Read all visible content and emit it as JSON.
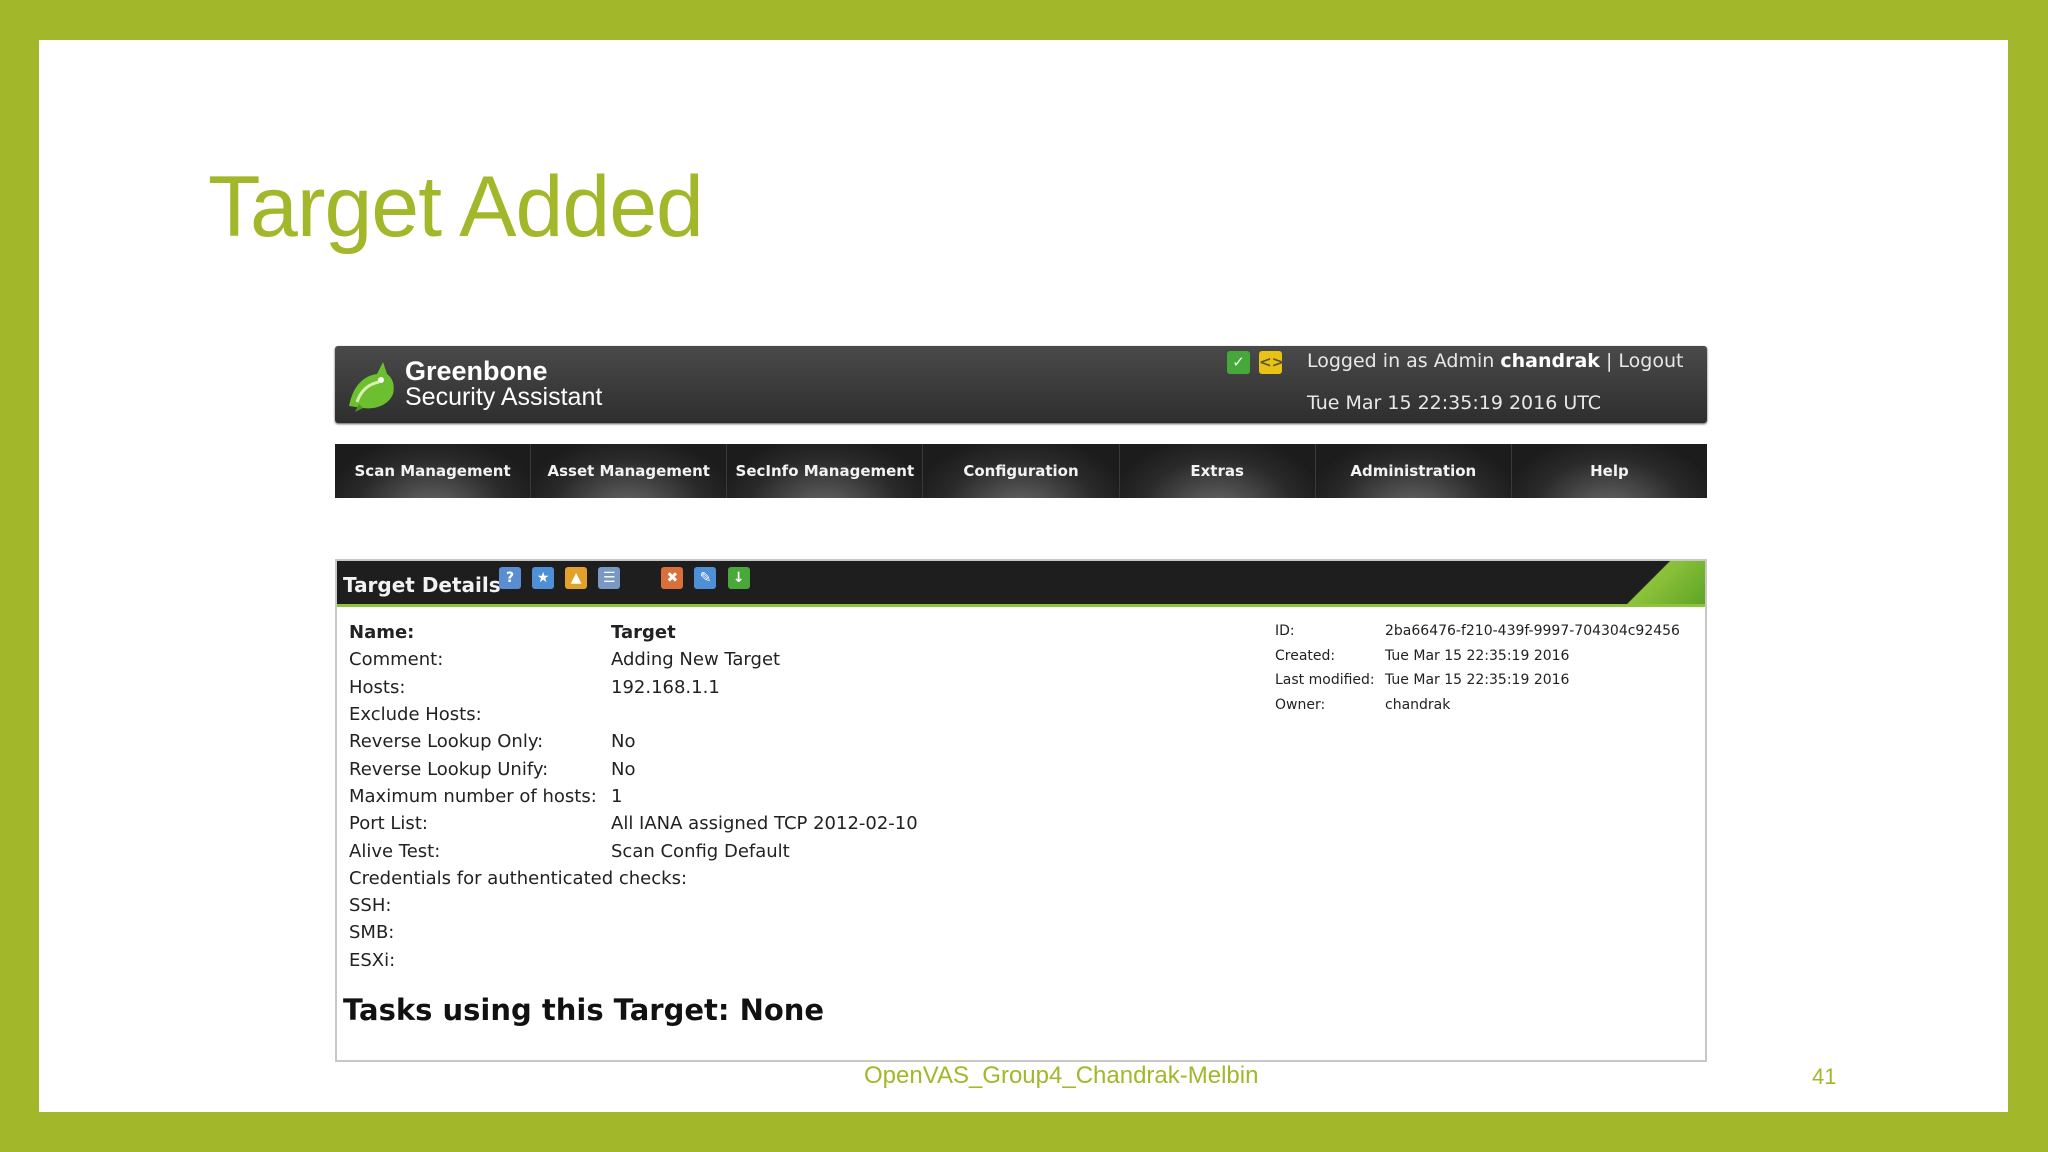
{
  "slide": {
    "title": "Target Added",
    "footer": "OpenVAS_Group4_Chandrak-Melbin",
    "page_number": "41",
    "accent_color": "#a3b72a"
  },
  "app": {
    "logo_line1": "Greenbone",
    "logo_line2": "Security Assistant",
    "header_icons": [
      "scan-status-icon",
      "code-icon"
    ],
    "login_prefix": "Logged in as Admin",
    "user": "chandrak",
    "separator": "|",
    "logout_label": "Logout",
    "datetime": "Tue Mar 15 22:35:19 2016 UTC"
  },
  "nav": {
    "items": [
      "Scan Management",
      "Asset Management",
      "SecInfo Management",
      "Configuration",
      "Extras",
      "Administration",
      "Help"
    ]
  },
  "panel": {
    "title": "Target Details",
    "toolbar_icons": [
      "help-icon",
      "new-icon",
      "clone-icon",
      "list-icon",
      "delete-icon",
      "edit-icon",
      "export-icon"
    ],
    "fields": [
      {
        "label": "Name:",
        "value": "Target"
      },
      {
        "label": "Comment:",
        "value": "Adding New Target"
      },
      {
        "label": "Hosts:",
        "value": "192.168.1.1"
      },
      {
        "label": "Exclude Hosts:",
        "value": ""
      },
      {
        "label": "Reverse Lookup Only:",
        "value": "No"
      },
      {
        "label": "Reverse Lookup Unify:",
        "value": "No"
      },
      {
        "label": "Maximum number of hosts:",
        "value": "1"
      },
      {
        "label": "Port List:",
        "value": "All IANA assigned TCP 2012-02-10"
      },
      {
        "label": "Alive Test:",
        "value": "Scan Config Default"
      },
      {
        "label": "Credentials for authenticated checks:",
        "value": ""
      },
      {
        "label": "SSH:",
        "value": ""
      },
      {
        "label": "SMB:",
        "value": ""
      },
      {
        "label": "ESXi:",
        "value": ""
      }
    ],
    "meta": [
      {
        "label": "ID:",
        "value": "2ba66476-f210-439f-9997-704304c92456"
      },
      {
        "label": "Created:",
        "value": "Tue Mar 15 22:35:19 2016"
      },
      {
        "label": "Last modified:",
        "value": "Tue Mar 15 22:35:19 2016"
      },
      {
        "label": "Owner:",
        "value": "chandrak"
      }
    ],
    "tasks_heading": "Tasks using this Target: None"
  }
}
